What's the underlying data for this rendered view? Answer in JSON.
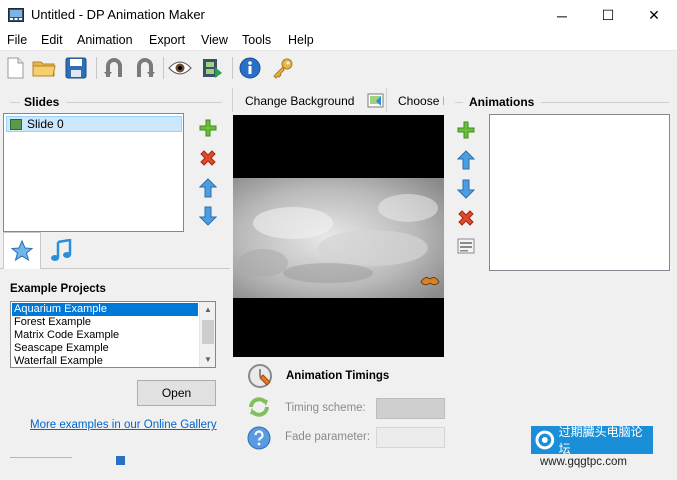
{
  "window": {
    "title": "Untitled - DP Animation Maker",
    "minimize": "─",
    "maximize": "☐",
    "close": "✕"
  },
  "menu": [
    "File",
    "Edit",
    "Animation",
    "Export",
    "View",
    "Tools",
    "Help"
  ],
  "toolbar": {
    "icons": [
      "new-file-icon",
      "open-folder-icon",
      "save-icon",
      "undo-icon",
      "redo-icon",
      "preview-eye-icon",
      "export-film-icon",
      "info-icon",
      "key-icon"
    ]
  },
  "slides": {
    "label": "Slides",
    "items": [
      "Slide 0"
    ]
  },
  "slide_buttons": [
    "add-icon",
    "delete-icon",
    "up-arrow-icon",
    "down-arrow-icon"
  ],
  "tabs": [
    "star-icon",
    "music-note-icon"
  ],
  "examples": {
    "label": "Example Projects",
    "items": [
      "Aquarium Example",
      "Forest Example",
      "Matrix Code Example",
      "Seascape Example",
      "Waterfall Example"
    ],
    "selected_index": 0,
    "open_label": "Open",
    "gallery_link": "More examples in our Online Gallery"
  },
  "canvas": {
    "change_background": "Change Background",
    "choose_effect": "Choose E"
  },
  "animations": {
    "label": "Animations"
  },
  "timings": {
    "label": "Animation Timings",
    "timing_scheme": "Timing scheme:",
    "fade_parameter": "Fade parameter:"
  },
  "watermark": {
    "text": "过期臓头电脑论坛",
    "url": "www.gqgtpc.com"
  },
  "colors": {
    "selection": "#0078d7",
    "slide_selection": "#cce8ff",
    "link": "#0066cc",
    "watermark": "#1a8fd8"
  }
}
